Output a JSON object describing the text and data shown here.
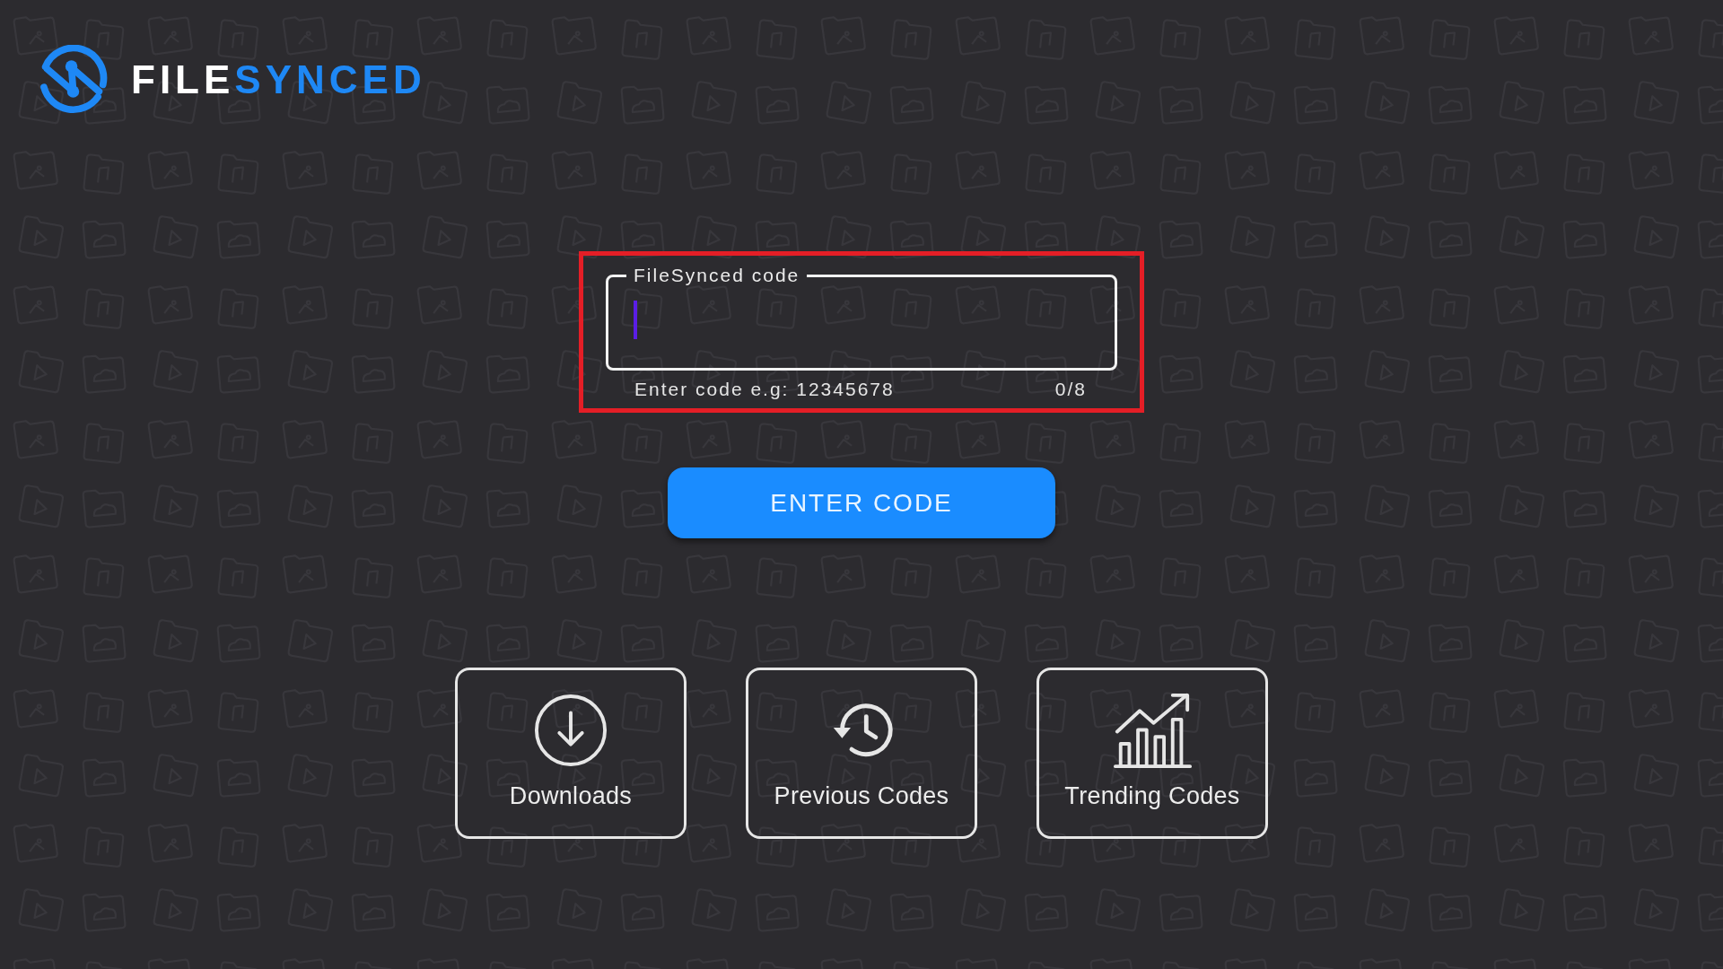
{
  "logo": {
    "wordmark": [
      {
        "text": "FILE",
        "color": "#ffffff"
      },
      {
        "text": "SYNCED",
        "color": "#1e88f5"
      }
    ]
  },
  "code_field": {
    "label": "FileSynced code",
    "highlighted": true,
    "focused": true,
    "helper_text": "Enter code e.g: 12345678",
    "counter": "0/8"
  },
  "enter_button": {
    "label": "ENTER CODE"
  },
  "shortcuts": [
    {
      "kind": "download",
      "label": "Downloads"
    },
    {
      "kind": "history",
      "label": "Previous Codes"
    },
    {
      "kind": "trending",
      "label": "Trending Codes"
    }
  ]
}
